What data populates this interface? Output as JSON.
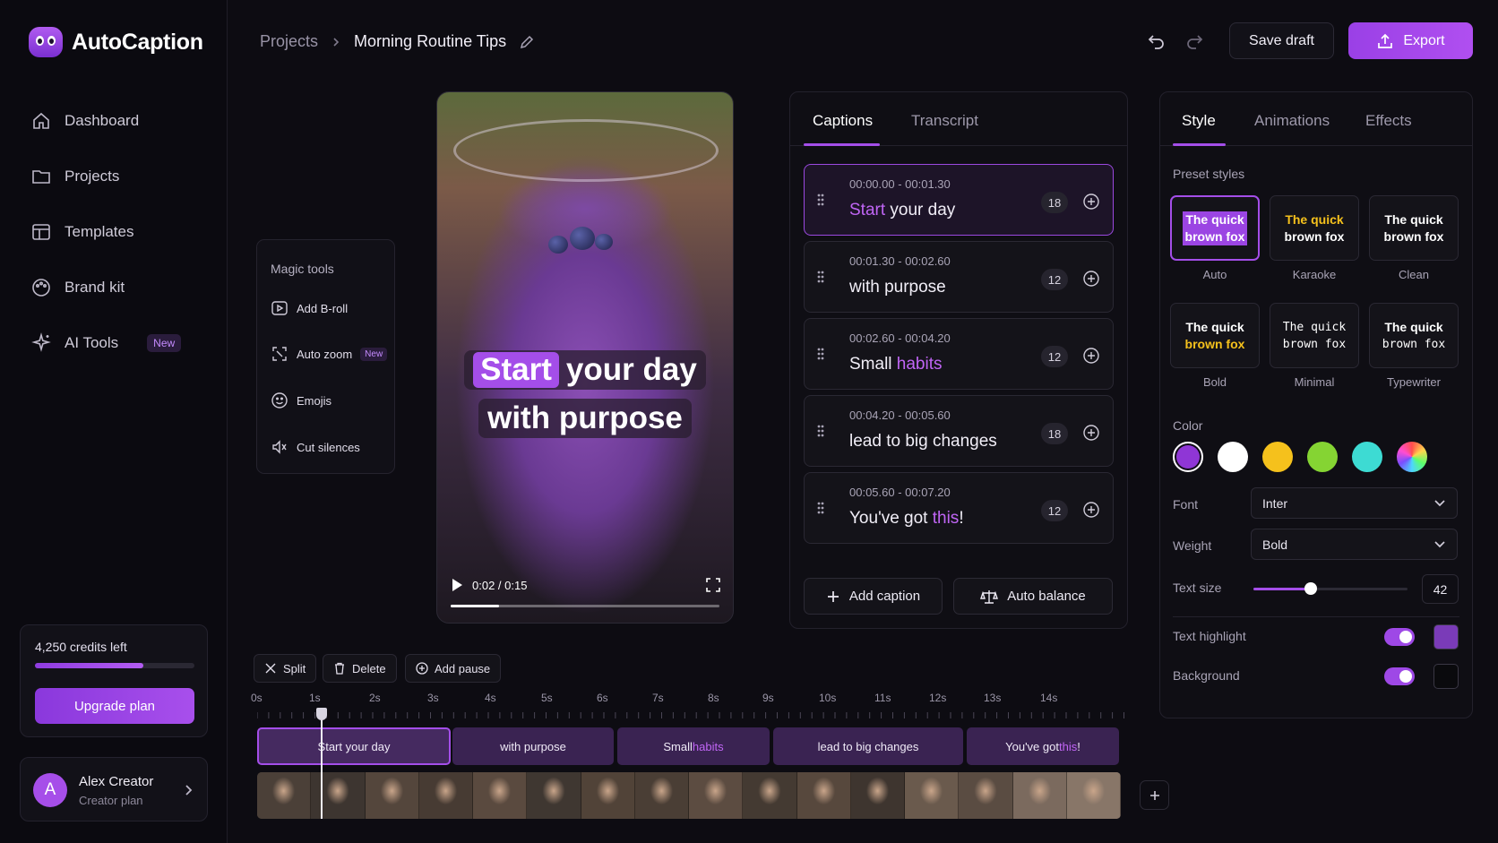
{
  "app": {
    "name": "AutoCaption"
  },
  "sidebar": {
    "items": [
      {
        "label": "Dashboard",
        "icon": "home-icon"
      },
      {
        "label": "Projects",
        "icon": "folder-icon"
      },
      {
        "label": "Templates",
        "icon": "template-icon"
      },
      {
        "label": "Brand kit",
        "icon": "palette-icon"
      },
      {
        "label": "AI Tools",
        "icon": "sparkles-icon",
        "badge": "New"
      }
    ],
    "credits": {
      "text": "4,250 credits left",
      "fraction": 0.68,
      "upgrade_label": "Upgrade plan"
    },
    "user": {
      "initial": "A",
      "name": "Alex Creator",
      "plan": "Creator plan"
    }
  },
  "header": {
    "breadcrumb_root": "Projects",
    "project_title": "Morning Routine Tips",
    "save_label": "Save draft",
    "export_label": "Export"
  },
  "video": {
    "caption_line1_highlight": "Start",
    "caption_line1_rest": "your day",
    "caption_line2": "with purpose",
    "time": "0:02 / 0:15",
    "progress": 0.18
  },
  "magic_tools": {
    "title": "Magic tools",
    "items": [
      {
        "label": "Add B-roll"
      },
      {
        "label": "Auto zoom",
        "badge": "New"
      },
      {
        "label": "Emojis"
      },
      {
        "label": "Cut silences"
      }
    ]
  },
  "captions_panel": {
    "tabs": [
      "Captions",
      "Transcript"
    ],
    "items": [
      {
        "time": "00:00.00 - 00:01.30",
        "highlight": "Start",
        "rest": " your day",
        "count": "18"
      },
      {
        "time": "00:01.30 - 00:02.60",
        "pre": "with purpose",
        "count": "12"
      },
      {
        "time": "00:02.60 - 00:04.20",
        "pre": "Small ",
        "highlight": "habits",
        "count": "12"
      },
      {
        "time": "00:04.20 - 00:05.60",
        "pre": "lead to big changes",
        "count": "18"
      },
      {
        "time": "00:05.60 - 00:07.20",
        "pre": "You've got ",
        "highlight": "this",
        "post": "!",
        "count": "12"
      }
    ],
    "add_caption_label": "Add caption",
    "auto_balance_label": "Auto balance"
  },
  "style_panel": {
    "tabs": [
      "Style",
      "Animations",
      "Effects"
    ],
    "preset_label": "Preset styles",
    "presets": [
      {
        "name": "Auto",
        "l1": "The quick",
        "l2": "brown fox"
      },
      {
        "name": "Karaoke",
        "l1": "The quick",
        "l2": "brown fox"
      },
      {
        "name": "Clean",
        "l1": "The quick",
        "l2": "brown fox"
      },
      {
        "name": "Bold",
        "l1": "The quick",
        "l2": "brown fox"
      },
      {
        "name": "Minimal",
        "l1": "The quick",
        "l2": "brown fox"
      },
      {
        "name": "Typewriter",
        "l1": "The quick",
        "l2": "brown fox"
      }
    ],
    "color_label": "Color",
    "colors": [
      "#8f36d6",
      "#ffffff",
      "#f5c11c",
      "#85d433",
      "#3ddbd3",
      "rainbow"
    ],
    "font_label": "Font",
    "font_value": "Inter",
    "weight_label": "Weight",
    "weight_value": "Bold",
    "text_size_label": "Text size",
    "text_size_value": "42",
    "text_size_fraction": 0.37,
    "highlight_label": "Text highlight",
    "highlight_color": "#7a3bb8",
    "background_label": "Background",
    "background_color": "#0a0a0d"
  },
  "timeline": {
    "buttons": [
      "Split",
      "Delete",
      "Add pause"
    ],
    "ticks": [
      "0s",
      "1s",
      "2s",
      "3s",
      "4s",
      "5s",
      "6s",
      "7s",
      "8s",
      "9s",
      "10s",
      "11s",
      "12s",
      "13s",
      "14s"
    ],
    "clips": [
      {
        "pre": "Start your day"
      },
      {
        "pre": "with purpose"
      },
      {
        "pre": "Small ",
        "highlight": "habits"
      },
      {
        "pre": "lead to big changes"
      },
      {
        "pre": "You've got ",
        "highlight": "this",
        "post": "!"
      }
    ]
  }
}
